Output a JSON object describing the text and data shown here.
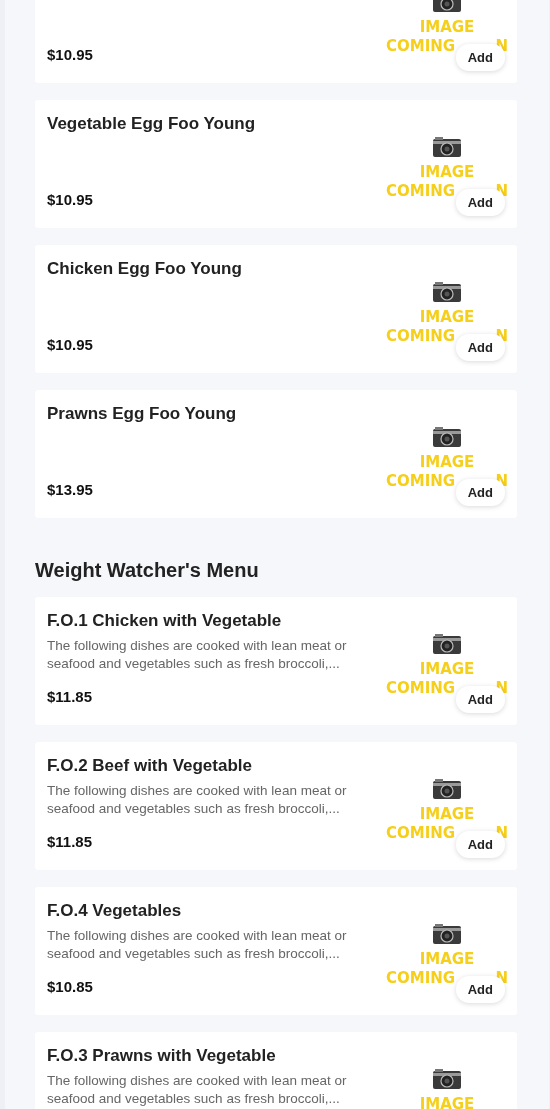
{
  "sections": [
    {
      "items": [
        {
          "price": "$10.95",
          "image_text": [
            "IMAGE",
            "COMING"
          ],
          "image_tail": "N",
          "button": "Add"
        },
        {
          "name": "Vegetable Egg Foo Young",
          "price": "$10.95",
          "image_text": [
            "IMAGE",
            "COMING"
          ],
          "image_tail": "N",
          "button": "Add"
        },
        {
          "name": "Chicken Egg Foo Young",
          "price": "$10.95",
          "image_text": [
            "IMAGE",
            "COMING"
          ],
          "image_tail": "N",
          "button": "Add"
        },
        {
          "name": "Prawns Egg Foo Young",
          "price": "$13.95",
          "image_text": [
            "IMAGE",
            "COMING"
          ],
          "image_tail": "N",
          "button": "Add"
        }
      ]
    },
    {
      "title": "Weight Watcher's Menu",
      "items": [
        {
          "name": "F.O.1 Chicken with Vegetable",
          "description": "The following dishes are cooked with lean meat or seafood and vegetables such as fresh broccoli,...",
          "price": "$11.85",
          "image_text": [
            "IMAGE",
            "COMING"
          ],
          "image_tail": "N",
          "button": "Add"
        },
        {
          "name": "F.O.2 Beef with Vegetable",
          "description": "The following dishes are cooked with lean meat or seafood and vegetables such as fresh broccoli,...",
          "price": "$11.85",
          "image_text": [
            "IMAGE",
            "COMING"
          ],
          "image_tail": "N",
          "button": "Add"
        },
        {
          "name": "F.O.4 Vegetables",
          "description": "The following dishes are cooked with lean meat or seafood and vegetables such as fresh broccoli,...",
          "price": "$10.85",
          "image_text": [
            "IMAGE",
            "COMING"
          ],
          "image_tail": "N",
          "button": "Add"
        },
        {
          "name": "F.O.3 Prawns with Vegetable",
          "description": "The following dishes are cooked with lean meat or seafood and vegetables such as fresh broccoli,...",
          "image_text": [
            "IMAGE"
          ]
        }
      ]
    }
  ]
}
